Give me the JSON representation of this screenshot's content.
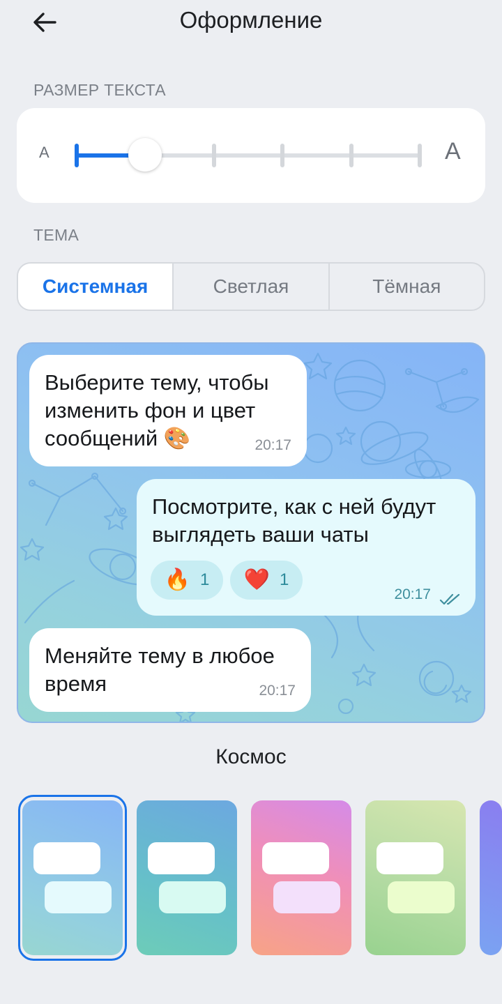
{
  "header": {
    "title": "Оформление"
  },
  "text_size": {
    "section_label": "РАЗМЕР ТЕКСТА",
    "small_label": "A",
    "large_label": "A",
    "steps": 6,
    "current_step": 2
  },
  "theme": {
    "section_label": "ТЕМА",
    "options": [
      "Системная",
      "Светлая",
      "Тёмная"
    ],
    "selected": "Системная"
  },
  "preview": {
    "messages": [
      {
        "type": "incoming",
        "text": "Выберите тему, чтобы изменить фон и цвет сообщений 🎨",
        "time": "20:17"
      },
      {
        "type": "outgoing",
        "text": "Посмотрите, как с ней будут выглядеть ваши чаты",
        "time": "20:17",
        "status_icon": "double-check-icon",
        "reactions": [
          {
            "emoji": "🔥",
            "count": "1"
          },
          {
            "emoji": "❤️",
            "count": "1"
          }
        ]
      },
      {
        "type": "incoming",
        "text": "Меняйте тему в любое время",
        "time": "20:17"
      }
    ]
  },
  "wallpaper": {
    "selected_name": "Космос",
    "themes": [
      {
        "key": "space",
        "selected": true
      },
      {
        "key": "travel",
        "selected": false
      },
      {
        "key": "love",
        "selected": false
      },
      {
        "key": "nature",
        "selected": false
      }
    ]
  },
  "colors": {
    "accent": "#1a73e8",
    "outgoing_bubble": "#e5fafd",
    "reaction_bg": "#c7edf3"
  }
}
